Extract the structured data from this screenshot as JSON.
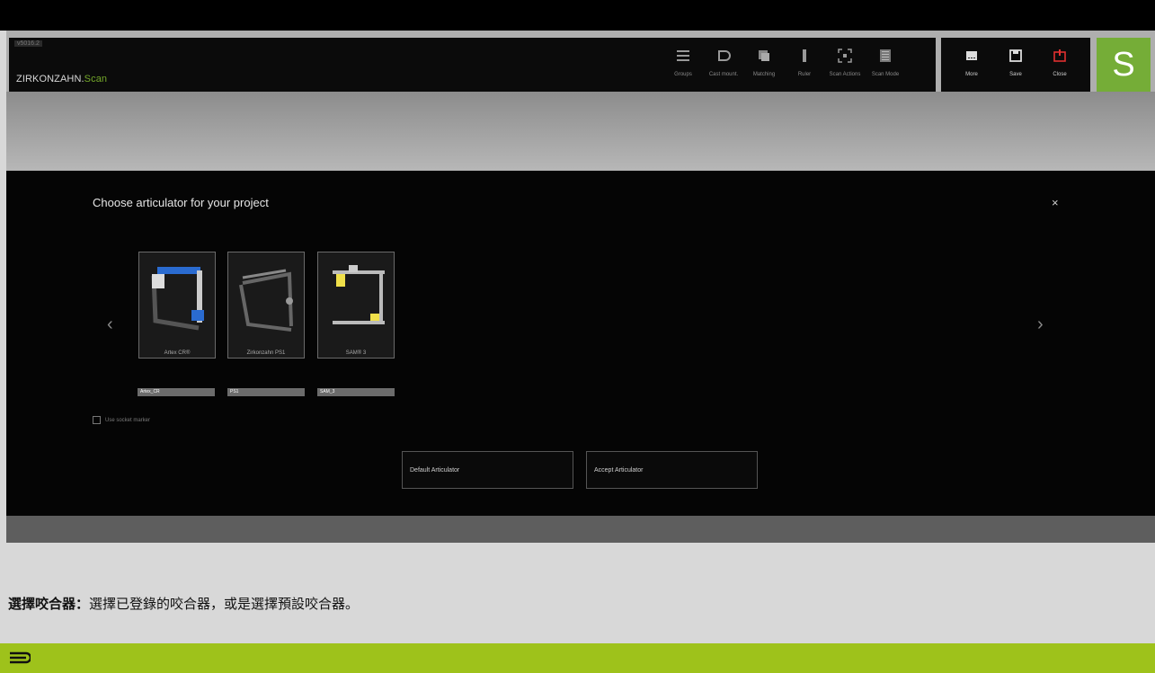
{
  "app": {
    "version": "v5016.2",
    "brand_main": "ZIRKONZAHN.",
    "brand_accent": "Scan",
    "logo_letter": "S",
    "accent_color": "#75ad37"
  },
  "toolbar": {
    "tools": [
      {
        "label": "Groups",
        "icon": "groups-icon"
      },
      {
        "label": "Cast mount.",
        "icon": "cast-mount-icon"
      },
      {
        "label": "Matching",
        "icon": "matching-icon"
      },
      {
        "label": "Ruler",
        "icon": "ruler-icon"
      },
      {
        "label": "Scan Actions",
        "icon": "scan-actions-icon"
      },
      {
        "label": "Scan Mode",
        "icon": "scan-mode-icon"
      }
    ],
    "right_tools": [
      {
        "label": "More",
        "icon": "more-icon"
      },
      {
        "label": "Save",
        "icon": "save-icon"
      },
      {
        "label": "Close",
        "icon": "power-icon",
        "color": "#e03030"
      }
    ]
  },
  "dialog": {
    "title": "Choose articulator for your project",
    "close": "×",
    "prev": "‹",
    "next": "›",
    "articulators": [
      {
        "name": "Artex CR®",
        "field": "Artex_CR"
      },
      {
        "name": "Zirkonzahn PS1",
        "field": "PS1"
      },
      {
        "name": "SAM® 3",
        "field": "SAM_3"
      }
    ],
    "checkbox_label": "Use socket marker",
    "default_button": "Default Articulator",
    "accept_button": "Accept Articulator"
  },
  "caption": {
    "bold": "選擇咬合器：",
    "text": "選擇已登錄的咬合器，或是選擇預設咬合器。"
  },
  "footer": {
    "color": "#9ec21b"
  }
}
